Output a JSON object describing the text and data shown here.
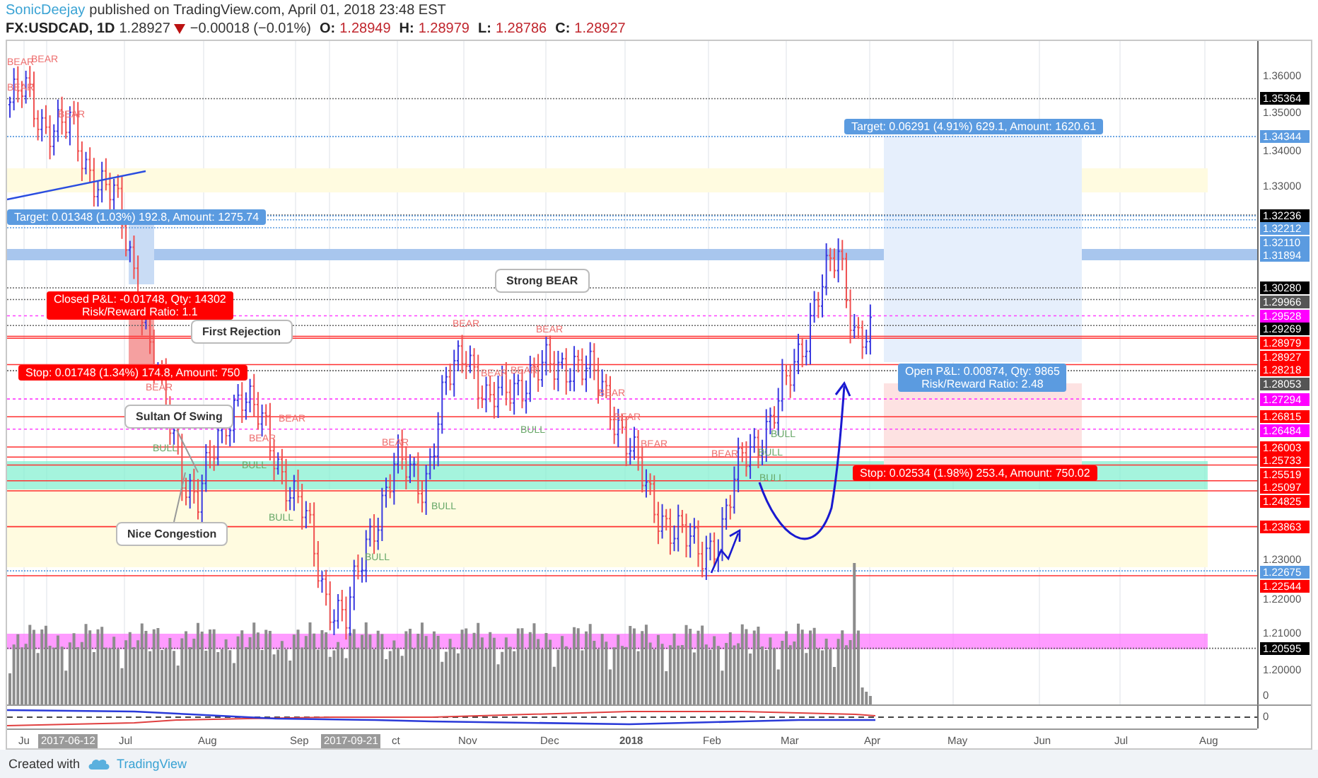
{
  "header": {
    "author": "SonicDeejay",
    "published": "published on TradingView.com, April 01, 2018 23:48 EST"
  },
  "quote": {
    "symbol": "FX:USDCAD, 1D",
    "last": "1.28927",
    "change": "−0.00018 (−0.01%)",
    "ohlc": [
      {
        "key": "O:",
        "value": "1.28949"
      },
      {
        "key": "H:",
        "value": "1.28979"
      },
      {
        "key": "L:",
        "value": "1.28786"
      },
      {
        "key": "C:",
        "value": "1.28927"
      }
    ]
  },
  "annotations": [
    {
      "kind": "target",
      "lines": [
        "Target: 0.06291 (4.91%) 629.1, Amount: 1620.61"
      ]
    },
    {
      "kind": "target",
      "lines": [
        "Target: 0.01348 (1.03%) 192.8, Amount: 1275.74"
      ]
    },
    {
      "kind": "callout",
      "lines": [
        "Strong BEAR"
      ]
    },
    {
      "kind": "stop",
      "lines": [
        "Closed P&L: -0.01748, Qty: 14302",
        "Risk/Reward Ratio: 1.1"
      ]
    },
    {
      "kind": "callout",
      "lines": [
        "First Rejection"
      ]
    },
    {
      "kind": "stop",
      "lines": [
        "Stop: 0.01748 (1.34%) 174.8, Amount: 750"
      ]
    },
    {
      "kind": "target",
      "lines": [
        "Open P&L: 0.00874, Qty: 9865",
        "Risk/Reward Ratio: 2.48"
      ]
    },
    {
      "kind": "callout",
      "lines": [
        "Sultan Of Swing"
      ]
    },
    {
      "kind": "stop",
      "lines": [
        "Stop: 0.02534 (1.98%) 253.4, Amount: 750.02"
      ]
    },
    {
      "kind": "callout",
      "lines": [
        "Nice Congestion"
      ]
    }
  ],
  "signals": [
    {
      "kind": "bear",
      "text": "BEAR"
    },
    {
      "kind": "bear",
      "text": "BEAR"
    },
    {
      "kind": "bear",
      "text": "BEAR"
    },
    {
      "kind": "bear",
      "text": "BEAR"
    },
    {
      "kind": "bear",
      "text": "BEAR"
    },
    {
      "kind": "bear",
      "text": "BEAR"
    },
    {
      "kind": "bear",
      "text": "BEAR"
    },
    {
      "kind": "bear",
      "text": "BEAR"
    },
    {
      "kind": "bear",
      "text": "BEAR"
    },
    {
      "kind": "bear",
      "text": "BEAR"
    },
    {
      "kind": "bull",
      "text": "BULL"
    },
    {
      "kind": "bear",
      "text": "BEAR"
    },
    {
      "kind": "bear",
      "text": "BEAR"
    },
    {
      "kind": "bull",
      "text": "BULL"
    },
    {
      "kind": "bear",
      "text": "BEAR"
    },
    {
      "kind": "bull",
      "text": "BULL"
    },
    {
      "kind": "bear",
      "text": "BEAR"
    },
    {
      "kind": "bull",
      "text": "BULL"
    },
    {
      "kind": "bear",
      "text": "BEAR"
    },
    {
      "kind": "bull",
      "text": "BULL"
    },
    {
      "kind": "bear",
      "text": "BEAR"
    },
    {
      "kind": "bull",
      "text": "BULL"
    },
    {
      "kind": "bull",
      "text": "BULL"
    },
    {
      "kind": "bull",
      "text": "BULL"
    },
    {
      "kind": "bull",
      "text": "BULL"
    }
  ],
  "price_axis": [
    {
      "kind": "tick",
      "label": "1.36000"
    },
    {
      "kind": "tag",
      "label": "1.35364",
      "color": "#000000"
    },
    {
      "kind": "tick",
      "label": "1.35000"
    },
    {
      "kind": "tag",
      "label": "1.34344",
      "color": "#5b9be0"
    },
    {
      "kind": "tick",
      "label": "1.34000"
    },
    {
      "kind": "tick",
      "label": "1.33000"
    },
    {
      "kind": "tag",
      "label": "1.32236",
      "color": "#000000"
    },
    {
      "kind": "tag",
      "label": "1.32212",
      "color": "#5b9be0"
    },
    {
      "kind": "tag",
      "label": "1.32110",
      "color": "#5b9be0"
    },
    {
      "kind": "tag",
      "label": "1.31894",
      "color": "#5b9be0"
    },
    {
      "kind": "tag",
      "label": "1.30280",
      "color": "#000000"
    },
    {
      "kind": "tag",
      "label": "1.29966",
      "color": "#555555"
    },
    {
      "kind": "tag",
      "label": "1.29528",
      "color": "#ff00ff"
    },
    {
      "kind": "tag",
      "label": "1.29269",
      "color": "#000000"
    },
    {
      "kind": "tag",
      "label": "1.28979",
      "color": "#ff0000"
    },
    {
      "kind": "tag",
      "label": "1.28927",
      "color": "#ff0000"
    },
    {
      "kind": "tag",
      "label": "1.28218",
      "color": "#ff0000"
    },
    {
      "kind": "tag",
      "label": "1.28053",
      "color": "#555555"
    },
    {
      "kind": "tag",
      "label": "1.27294",
      "color": "#ff00ff"
    },
    {
      "kind": "tag",
      "label": "1.26815",
      "color": "#ff0000"
    },
    {
      "kind": "tag",
      "label": "1.26484",
      "color": "#ff00ff"
    },
    {
      "kind": "tag",
      "label": "1.26003",
      "color": "#ff0000"
    },
    {
      "kind": "tag",
      "label": "1.25733",
      "color": "#ff0000"
    },
    {
      "kind": "tag",
      "label": "1.25519",
      "color": "#ff0000"
    },
    {
      "kind": "tag",
      "label": "1.25097",
      "color": "#ff0000"
    },
    {
      "kind": "tag",
      "label": "1.24825",
      "color": "#ff0000"
    },
    {
      "kind": "tag",
      "label": "1.23863",
      "color": "#ff0000"
    },
    {
      "kind": "tick",
      "label": "1.23000"
    },
    {
      "kind": "tag",
      "label": "1.22675",
      "color": "#5b9be0"
    },
    {
      "kind": "tag",
      "label": "1.22544",
      "color": "#ff0000"
    },
    {
      "kind": "tick",
      "label": "1.22000"
    },
    {
      "kind": "tick",
      "label": "1.21000"
    },
    {
      "kind": "tag",
      "label": "1.20595",
      "color": "#000000"
    },
    {
      "kind": "tick",
      "label": "1.20000"
    }
  ],
  "volume_axis_label": "0",
  "indicator_axis_label": "0",
  "time_axis": [
    {
      "kind": "month",
      "label": "Ju"
    },
    {
      "kind": "highlight",
      "label": "2017-06-12"
    },
    {
      "kind": "month",
      "label": "Jul"
    },
    {
      "kind": "month",
      "label": "Aug"
    },
    {
      "kind": "month",
      "label": "Sep"
    },
    {
      "kind": "highlight",
      "label": "2017-09-21"
    },
    {
      "kind": "month",
      "label": "ct"
    },
    {
      "kind": "month",
      "label": "Nov"
    },
    {
      "kind": "month",
      "label": "Dec"
    },
    {
      "kind": "year",
      "label": "2018"
    },
    {
      "kind": "month",
      "label": "Feb"
    },
    {
      "kind": "month",
      "label": "Mar"
    },
    {
      "kind": "month",
      "label": "Apr"
    },
    {
      "kind": "month",
      "label": "May"
    },
    {
      "kind": "month",
      "label": "Jun"
    },
    {
      "kind": "month",
      "label": "Jul"
    },
    {
      "kind": "month",
      "label": "Aug"
    }
  ],
  "footer": {
    "text": "Created with",
    "brand": "TradingView"
  }
}
